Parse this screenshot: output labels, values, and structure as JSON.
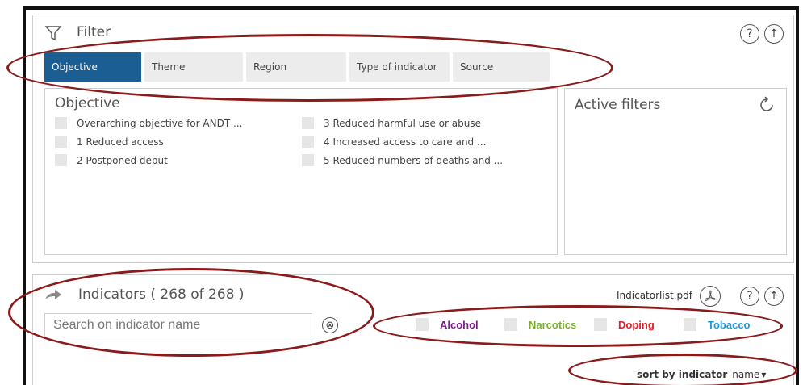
{
  "filter": {
    "title": "Filter",
    "tabs": [
      {
        "label": "Objective",
        "active": true
      },
      {
        "label": "Theme",
        "active": false
      },
      {
        "label": "Region",
        "active": false
      },
      {
        "label": "Type of indicator",
        "active": false
      },
      {
        "label": "Source",
        "active": false
      }
    ],
    "objective": {
      "heading": "Objective",
      "options": [
        "Overarching objective for ANDT ...",
        "1 Reduced access",
        "2 Postponed debut",
        "3 Reduced harmful use or abuse",
        "4 Increased access to care and ...",
        "5 Reduced numbers of deaths and ..."
      ]
    },
    "active_filters": {
      "heading": "Active filters"
    },
    "help_symbol": "?",
    "top_symbol": "↑"
  },
  "indicators": {
    "title": "Indicators ( 268 of 268 )",
    "pdf_label": "Indicatorlist.pdf",
    "search": {
      "placeholder": "Search on indicator name",
      "value": ""
    },
    "clear_symbol": "⊗",
    "substances": [
      {
        "label": "Alcohol",
        "color": "#7a1f8a"
      },
      {
        "label": "Narcotics",
        "color": "#7ab02a"
      },
      {
        "label": "Doping",
        "color": "#e0202a"
      },
      {
        "label": "Tobacco",
        "color": "#1e9bd7"
      }
    ],
    "sort": {
      "label": "sort by indicator",
      "value": "name",
      "arrow": "▾"
    },
    "help_symbol": "?",
    "top_symbol": "↑"
  },
  "colors": {
    "active_tab": "#1b5e93",
    "annotation": "#8b1a1a"
  }
}
